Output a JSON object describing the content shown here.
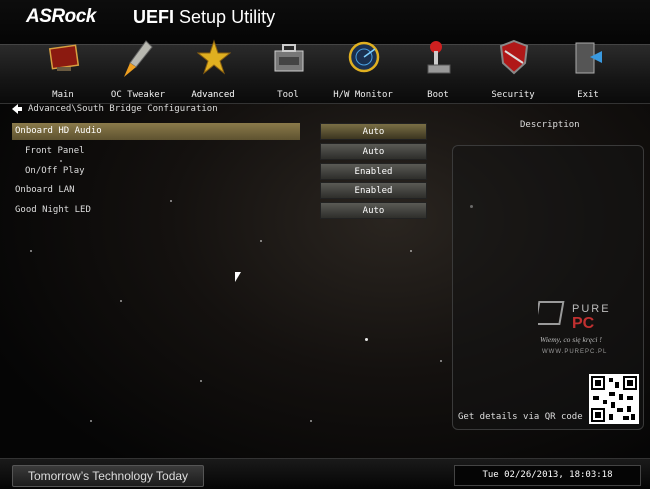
{
  "header": {
    "brand": "ASRock",
    "title_bold": "UEFI",
    "title_rest": "Setup Utility"
  },
  "nav": {
    "items": [
      {
        "label": "Main",
        "icon": "main-monitor-icon"
      },
      {
        "label": "OC Tweaker",
        "icon": "rocket-icon"
      },
      {
        "label": "Advanced",
        "icon": "star-icon"
      },
      {
        "label": "Tool",
        "icon": "toolbox-icon"
      },
      {
        "label": "H/W Monitor",
        "icon": "radar-icon"
      },
      {
        "label": "Boot",
        "icon": "joystick-icon"
      },
      {
        "label": "Security",
        "icon": "shield-icon"
      },
      {
        "label": "Exit",
        "icon": "exit-door-icon"
      }
    ],
    "active": "Advanced"
  },
  "breadcrumb": "Advanced\\South Bridge Configuration",
  "settings": [
    {
      "label": "Onboard HD Audio",
      "value": "Auto",
      "indent": false,
      "selected": true
    },
    {
      "label": "Front Panel",
      "value": "Auto",
      "indent": true,
      "selected": false
    },
    {
      "label": "On/Off Play",
      "value": "Enabled",
      "indent": true,
      "selected": false
    },
    {
      "label": "Onboard LAN",
      "value": "Enabled",
      "indent": false,
      "selected": false
    },
    {
      "label": "Good Night LED",
      "value": "Auto",
      "indent": false,
      "selected": false
    }
  ],
  "description": {
    "title": "Description",
    "qr_text": "Get details via QR code"
  },
  "watermark": {
    "brand_line1": "PURE",
    "brand_line2": "PC",
    "slogan": "Wiemy, co się kręci !",
    "url": "WWW.PUREPC.PL"
  },
  "footer": {
    "tagline": "Tomorrow’s Technology Today",
    "datetime": "Tue 02/26/2013, 18:03:18"
  },
  "colors": {
    "selected_row": "#8a7a4a",
    "value_box": "#4a4a45",
    "accent": "#ffffff"
  }
}
